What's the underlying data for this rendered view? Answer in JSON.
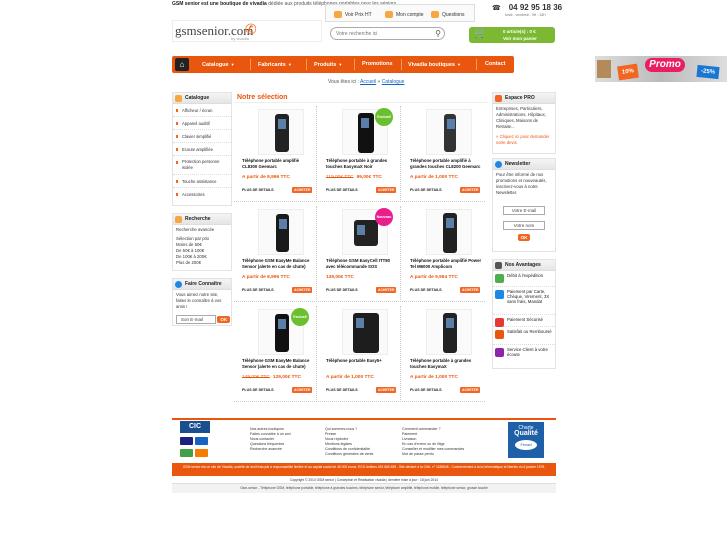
{
  "header": {
    "tagline_bold": "GSM senior est une boutique de vivadia",
    "tagline_rest": " dédiée aux produits téléphones portables pour les séniors",
    "logo_text": "gsmsenior.com",
    "logo_sub": "by vivadia",
    "top_links": [
      "Voir Prix HT",
      "Mon compte",
      "Questions"
    ],
    "phone": "04 92 95 18 36",
    "hours": "lundi - vendredi : 9H - 18H",
    "search_placeholder": "Votre recherche ici",
    "cart_line1": "0 article(s) : 0 €",
    "cart_line2": "Voir mon panier"
  },
  "nav": {
    "items": [
      "Catalogue",
      "Fabricants",
      "Produits",
      "Promotions",
      "Vivadia boutiques",
      "Contact"
    ]
  },
  "promo": {
    "badge1": "10%",
    "badge2": "Promo",
    "badge3": "-25%"
  },
  "breadcrumb": {
    "prefix": "Vous êtes ici :",
    "home": "Accueil",
    "sep": "»",
    "current": "Catalogue"
  },
  "left": {
    "catalogue_title": "Catalogue",
    "categories": [
      "Afficheur / écran",
      "Appareil auditif",
      "Clavier simplifié",
      "Ecoute amplifiée",
      "Protection personne isolée",
      "Touche assistance",
      "Accessoires"
    ],
    "search_title": "Recherche",
    "search_lines": [
      "Recherche avancée",
      "",
      "Sélection par prix",
      "Moins de 50€",
      "De 50€ à 100€",
      "De 100€ à 200€",
      "Plus de 200€"
    ],
    "know_title": "Faire Connaître",
    "know_text": "Vous aimez notre site, faites le connaître à vos amis !",
    "know_input": "Son E-mail",
    "ok": "OK"
  },
  "main": {
    "title": "Notre sélection",
    "details_label": "PLUS DE DETAILS",
    "buy_label": "ACHETER",
    "products": [
      {
        "name": "Téléphone portable amplifié CL8300 Geemarc",
        "old": "",
        "price": "A partir de 8,996 TTC",
        "badge": ""
      },
      {
        "name": "Téléphone portable à grandes touches EasymaX Noir",
        "old": "119,00€ TTC",
        "price": "99,00€ TTC",
        "badge": "Exclusif"
      },
      {
        "name": "Téléphone portable amplifié à grandes touches CL8200 Geemarc",
        "old": "",
        "price": "A partir de 1,000 TTC",
        "badge": ""
      },
      {
        "name": "Téléphone GSM EasyMe Balance Sensor (alerte en cas de chute)",
        "old": "",
        "price": "A partir de 8,996 TTC",
        "badge": ""
      },
      {
        "name": "Téléphone GSM EasyCell ITT80 avec télécommande SOS",
        "old": "",
        "price": "139,00€ TTC",
        "badge": "Nouveau"
      },
      {
        "name": "Téléphone portable amplifié Power Tel M6000 Amplicom",
        "old": "",
        "price": "A partir de 9,994 TTC",
        "badge": ""
      },
      {
        "name": "Téléphone GSM EasyMe Balance Sensor (alerte en cas de chute)",
        "old": "149,00€ TTC",
        "price": "129,00€ TTC",
        "badge": "Exclusif"
      },
      {
        "name": "Téléphone portable Easy5+",
        "old": "",
        "price": "A partir de 1,000 TTC",
        "badge": ""
      },
      {
        "name": "Téléphone portable à grandes touches EasymaX",
        "old": "",
        "price": "A partir de 1,000 TTC",
        "badge": ""
      }
    ]
  },
  "right": {
    "pro_title": "Espace PRO",
    "pro_text": "Entreprises, Particuliers, Administrations, Hôpitaux, Cliniques, Maisons de Retraite...",
    "pro_link": "» Cliquez ici pour demander votre devis",
    "news_title": "Newsletter",
    "news_text": "Pour être informé de nos promotions et nouveautés, inscrivez-vous à notre Newsletter.",
    "news_email": "Votre E-mail",
    "news_name": "Votre nom",
    "ok": "OK",
    "adv_title": "Nos Avantages",
    "advantages": [
      "Débit à l'expédition",
      "Paiement par Carte, Chèque, Virement, 3X sans frais, Mandat",
      "Paiement Sécurisé",
      "Satisfait ou Remboursé",
      "Service Client à votre écoute"
    ]
  },
  "footer": {
    "cic": "CIC",
    "col1": [
      "Nos autres boutiques",
      "Faites connaître à un ami",
      "Nous contacter",
      "Questions fréquentes",
      "Recherche avancée"
    ],
    "col2": [
      "Qui sommes-nous ?",
      "Presse",
      "Nous rejoindre",
      "Mentions légales",
      "Conditions de confidentialité",
      "Conditions générales de vente"
    ],
    "col3": [
      "Comment commander ?",
      "Paiement",
      "Livraison",
      "En cas d'erreur ou de litige",
      "Conseiller et modifier mes commandes",
      "Mot de passe perdu"
    ],
    "charte_top": "Charte",
    "charte_main": "Qualité",
    "charte_logo": "Fevad",
    "legal": "GSM senior est un site de Vivadia, société de droit français à responsabilité limitée et au capital social de 46 000 euros. RCS Antibes 492 666 695 - Site déclaré à la CNIL n° 1185646 - Conformément à la loi informatique et libertés du 6 janvier 1978.",
    "copyright": "Copyright © 2014 GSM senior | Conception et Réalisation vivadia | dernière mise à jour : 18 juin 2014",
    "keywords": "Gsm-senior - Téléphone GSM, téléphone portable, téléphone à grandes touches, téléphone senior, téléphone amplifié, téléphone mobile, téléphone senior, grosse touche"
  }
}
